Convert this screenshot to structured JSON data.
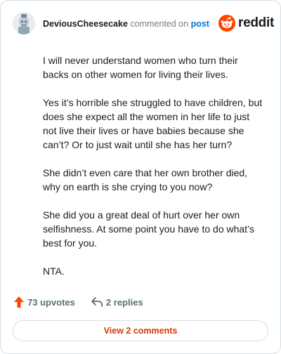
{
  "comment": {
    "username": "DeviousCheesecake",
    "action_text": "commented on",
    "target_text": "post",
    "brand": "reddit",
    "paragraphs": [
      "I will never understand women who turn their backs on other women for living their lives.",
      "Yes it’s horrible she struggled to have children, but does she expect all the women in her life to just not live their lives or have babies because she can’t? Or to just wait until she has her turn?",
      "She didn’t even care that her own brother died, why on earth is she crying to you now?",
      "She did you a great deal of hurt over her own selfishness. At some point you have to do what’s best for you.",
      "NTA."
    ]
  },
  "actions": {
    "upvotes": "73 upvotes",
    "replies": "2 replies",
    "view_comments": "View 2 comments"
  },
  "icons": {
    "upvote": "upvote-arrow-icon",
    "reply": "reply-arrow-icon",
    "brand": "reddit-snoo-icon",
    "avatar": "user-avatar"
  },
  "colors": {
    "accent": "#d93a00",
    "upvote": "#ff4500",
    "link": "#0079d3",
    "brand": "#ff4500"
  }
}
